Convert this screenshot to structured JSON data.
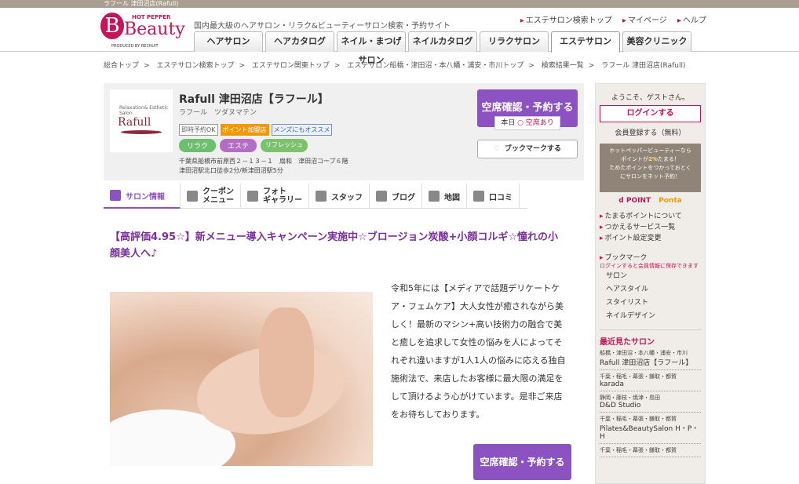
{
  "topbar": {
    "title": "ラフール 津田沼店(Rafull)"
  },
  "header": {
    "tagline": "国内最大級のヘアサロン・リラク&ビューティーサロン検索・予約サイト",
    "links": [
      "エステサロン検索トップ",
      "マイページ",
      "ヘルプ"
    ],
    "logo": {
      "hp": "HOT PEPPER",
      "brand": "Beauty",
      "produced": "PRODUCED BY RECRUIT"
    },
    "tabs": [
      "ヘアサロン",
      "ヘアカタログ",
      "ネイル・まつげサロン",
      "ネイルカタログ",
      "リラクサロン",
      "エステサロン",
      "美容クリニック"
    ],
    "active_tab_index": 5
  },
  "breadcrumb": [
    "総合トップ",
    "エステサロン検索トップ",
    "エステサロン関東トップ",
    "エステサロン船橋・津田沼・本八幡・浦安・市川トップ",
    "検索結果一覧",
    "ラフール 津田沼店(Rafull)"
  ],
  "salon": {
    "logo_small": "Relaxation& Esthetic Salon",
    "logo_name": "Rafull",
    "name": "Rafull 津田沼店【ラフール】",
    "kana": "ラフール　ツダヌマテン",
    "tags": [
      "即時予約OK",
      "ポイント加盟店",
      "メンズにもオススメ"
    ],
    "genres": [
      "リラク",
      "エステ",
      "リフレッシュ"
    ],
    "address": "千葉県船橋市前原西２－１３－１　扇和　津田沼コープ６階",
    "access": "津田沼駅北口徒歩2分/新津田沼駅5分",
    "reserve_button": "空席確認・予約する",
    "today_label": "本日",
    "today_status": "○ 空席あり",
    "bookmark_button": "ブックマークする"
  },
  "subnav": [
    {
      "label": "サロン情報",
      "icon": "home-icon"
    },
    {
      "label": "クーポン\nメニュー",
      "icon": "coupon-icon"
    },
    {
      "label": "フォト\nギャラリー",
      "icon": "photo-icon"
    },
    {
      "label": "スタッフ",
      "icon": "staff-icon"
    },
    {
      "label": "ブログ",
      "icon": "pen-icon"
    },
    {
      "label": "地図",
      "icon": "map-pin-icon"
    },
    {
      "label": "口コミ",
      "icon": "chat-icon"
    }
  ],
  "headline": "【高評価4.95☆】新メニュー導入キャンペーン実施中☆ブロージョン炭酸+小顔コルギ☆憧れの小顔美人へ♪",
  "body": "令和5年には【メディアで話題デリケートケア・フェムケア】大人女性が癒されながら美しく！最新のマシン+高い技術力の融合で美と癒しを追求して女性の悩みを人によってそれぞれ違いますが1人1人の悩みに応える独自施術法で、来店したお客様に最大限の満足をして頂けるよう心がけています。是非ご来店をお待ちしております。",
  "reserve_button_2": "空席確認・予約する",
  "sidebar": {
    "welcome": "ようこそ、ゲストさん。",
    "login": "ログインする",
    "register": "会員登録する（無料）",
    "point_promo_1": "ホットペッパービューティーなら",
    "point_promo_2a": "ポイントが",
    "point_promo_2b": "2%",
    "point_promo_2c": "たまる！",
    "point_promo_3": "ためたポイントをつかっておとく",
    "point_promo_4": "にサロンをネット予約！",
    "point_logos": [
      "d POINT",
      "Ponta"
    ],
    "links": [
      "たまるポイントについて",
      "つかえるサービス一覧",
      "ポイント設定変更"
    ],
    "bookmark_title": "ブックマーク",
    "bookmark_note": "ログインすると会員情報に保存できます",
    "bookmark_items": [
      "サロン",
      "ヘアスタイル",
      "スタイリスト",
      "ネイルデザイン"
    ],
    "recent_title": "最近見たサロン",
    "recent": [
      {
        "area": "船橋・津田沼・本八幡・浦安・市川",
        "name": "Rafull 津田沼店【ラフール】"
      },
      {
        "area": "千葉・稲毛・幕張・鎌取・都賀",
        "name": "karada"
      },
      {
        "area": "静岡・藤枝・焼津・島田",
        "name": "D&D Studio"
      },
      {
        "area": "千葉・稲毛・幕張・鎌取・都賀",
        "name": "Pilates&BeautySalon H・P・H"
      },
      {
        "area": "千葉・稲毛・幕張・鎌取・都賀",
        "name": ""
      }
    ]
  }
}
